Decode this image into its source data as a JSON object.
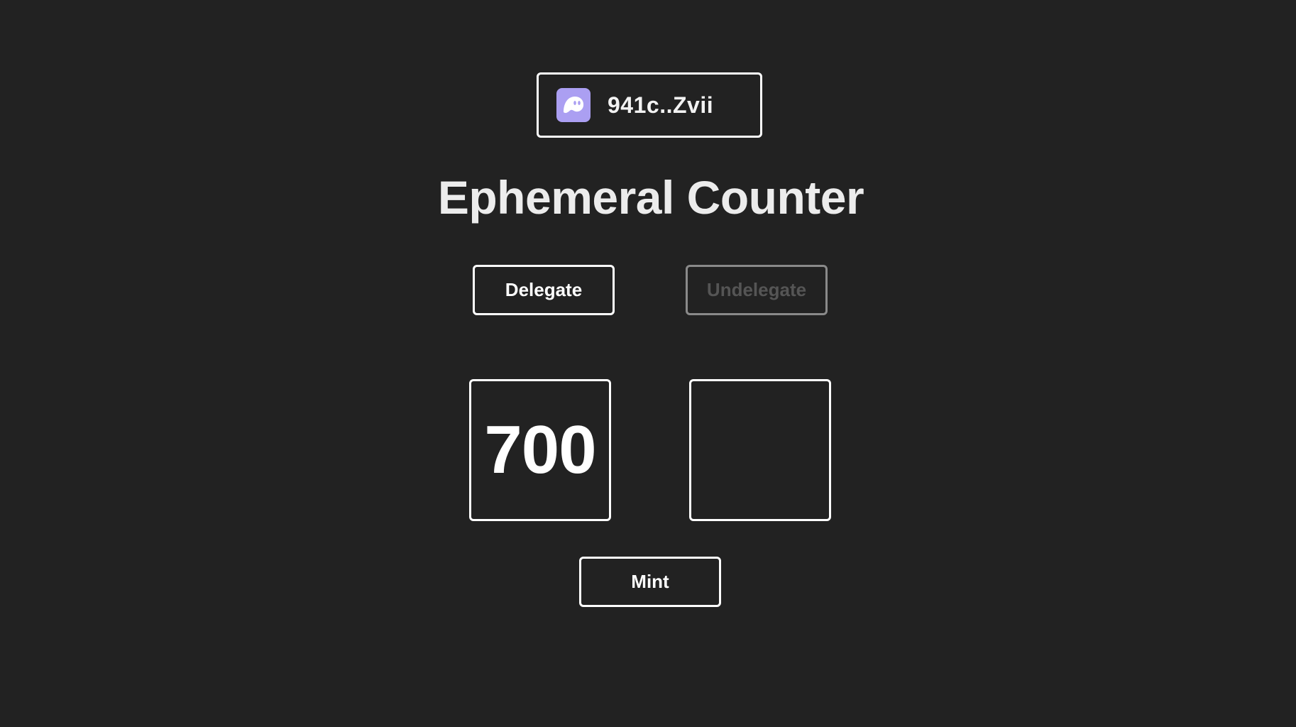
{
  "wallet": {
    "address": "941c..Zvii",
    "icon": "phantom-ghost-icon",
    "icon_color": "#ab9ff2"
  },
  "title": "Ephemeral Counter",
  "actions": {
    "delegate_label": "Delegate",
    "undelegate_label": "Undelegate",
    "undelegate_disabled": true,
    "mint_label": "Mint"
  },
  "counters": {
    "main_value": "700",
    "ephemeral_value": ""
  },
  "colors": {
    "background": "#222222",
    "foreground": "#ffffff",
    "disabled_text": "#555555",
    "disabled_border": "#8a8a8a"
  }
}
